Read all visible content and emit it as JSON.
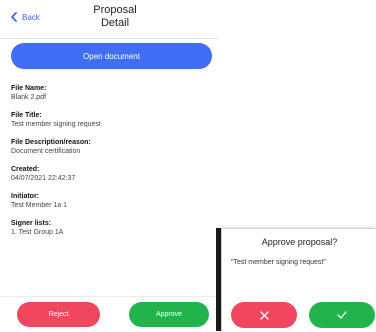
{
  "header": {
    "back_label": "Back",
    "title_line1": "Proposal",
    "title_line2": "Detail"
  },
  "open_document_label": "Open document",
  "fields": [
    {
      "label": "File Name:",
      "value": "Blank 2.pdf"
    },
    {
      "label": "File Title:",
      "value": "Test member signing request"
    },
    {
      "label": "File Description/reason:",
      "value": "Document certification"
    },
    {
      "label": "Created:",
      "value": "04/07/2021 22:42:37"
    },
    {
      "label": "Initiator:",
      "value": "Test Member 1a 1"
    },
    {
      "label": "Signer lists:",
      "value": "1. Test Group 1A"
    }
  ],
  "actions": {
    "reject_label": "Reject",
    "approve_label": "Approve"
  },
  "dialog": {
    "title": "Approve proposal?",
    "message": "\"Test member signing request\"",
    "cancel_icon": "close-icon",
    "confirm_icon": "checkmark-icon"
  },
  "colors": {
    "accent": "#3f6ef4",
    "danger": "#f0465e",
    "success": "#22b34a"
  }
}
